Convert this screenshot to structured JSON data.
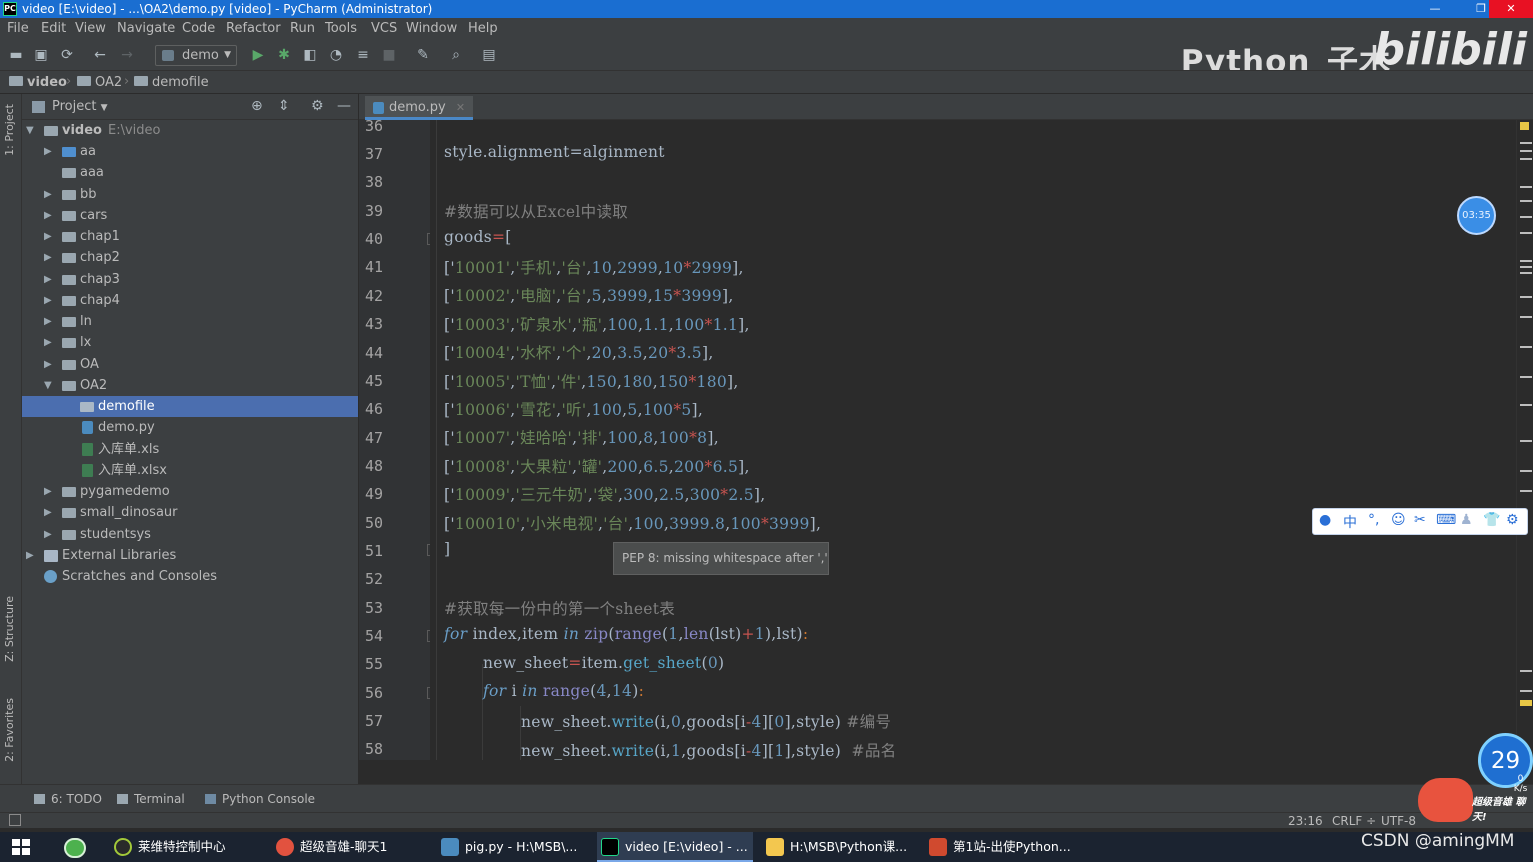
{
  "window": {
    "title": "video [E:\\video] - ...\\OA2\\demo.py [video] - PyCharm (Administrator)",
    "app_icon": "PC",
    "minimize": "—",
    "maximize": "❐",
    "close": "✕"
  },
  "menu": [
    "File",
    "Edit",
    "View",
    "Navigate",
    "Code",
    "Refactor",
    "Run",
    "Tools",
    "VCS",
    "Window",
    "Help"
  ],
  "toolbar": {
    "run_config": "demo"
  },
  "watermark": {
    "text": "Python_子木",
    "logo": "bilibili"
  },
  "breadcrumb": [
    "video",
    "OA2",
    "demofile"
  ],
  "left_strip": {
    "project_tab": "1: Project",
    "structure_tab": "Z: Structure",
    "favorites_tab": "2: Favorites"
  },
  "project": {
    "title": "Project",
    "root_label": "video",
    "root_path": "E:\\video",
    "items": [
      {
        "label": "aa"
      },
      {
        "label": "aaa"
      },
      {
        "label": "bb"
      },
      {
        "label": "cars"
      },
      {
        "label": "chap1"
      },
      {
        "label": "chap2"
      },
      {
        "label": "chap3"
      },
      {
        "label": "chap4"
      },
      {
        "label": "ln"
      },
      {
        "label": "lx"
      },
      {
        "label": "OA"
      },
      {
        "label": "OA2"
      },
      {
        "label": "demofile"
      },
      {
        "label": "demo.py"
      },
      {
        "label": "入库单.xls"
      },
      {
        "label": "入库单.xlsx"
      },
      {
        "label": "pygamedemo"
      },
      {
        "label": "small_dinosaur"
      },
      {
        "label": "studentsys"
      },
      {
        "label": "External Libraries"
      },
      {
        "label": "Scratches and Consoles"
      }
    ]
  },
  "editor": {
    "tab": "demo.py",
    "line_numbers": [
      "36",
      "37",
      "38",
      "39",
      "40",
      "41",
      "42",
      "43",
      "44",
      "45",
      "46",
      "47",
      "48",
      "49",
      "50",
      "51",
      "52",
      "53",
      "54",
      "55",
      "56",
      "57",
      "58"
    ],
    "lines": {
      "l37": "style.alignment=alginment",
      "l39": "#数据可以从Excel中读取",
      "l40_a": "goods",
      "l40_b": "=",
      "l40_c": "[",
      "l41": [
        "['",
        "10001'",
        ",",
        "'手机'",
        ",",
        "'台'",
        ",",
        "10",
        ",",
        "2999",
        ",",
        "10",
        "*",
        "2999",
        "],"
      ],
      "l42": [
        "['",
        "10002'",
        ",",
        "'电脑'",
        ",",
        "'台'",
        ",",
        "5",
        ",",
        "3999",
        ",",
        "15",
        "*",
        "3999",
        "],"
      ],
      "l43": [
        "['",
        "10003'",
        ",",
        "'矿泉水'",
        ",",
        "'瓶'",
        ",",
        "100",
        ",",
        "1.1",
        ",",
        "100",
        "*",
        "1.1",
        "],"
      ],
      "l44": [
        "['",
        "10004'",
        ",",
        "'水杯'",
        ",",
        "'个'",
        ",",
        "20",
        ",",
        "3.5",
        ",",
        "20",
        "*",
        "3.5",
        "],"
      ],
      "l45": [
        "['",
        "10005'",
        ",",
        "'T恤'",
        ",",
        "'件'",
        ",",
        "150",
        ",",
        "180",
        ",",
        "150",
        "*",
        "180",
        "],"
      ],
      "l46": [
        "['",
        "10006'",
        ",",
        "'雪花'",
        ",",
        "'听'",
        ",",
        "100",
        ",",
        "5",
        ",",
        "100",
        "*",
        "5",
        "],"
      ],
      "l47": [
        "['",
        "10007'",
        ",",
        "'娃哈哈'",
        ",",
        "'排'",
        ",",
        "100",
        ",",
        "8",
        ",",
        "100",
        "*",
        "8",
        "],"
      ],
      "l48": [
        "['",
        "10008'",
        ",",
        "'大果粒'",
        ",",
        "'罐'",
        ",",
        "200",
        ",",
        "6.5",
        ",",
        "200",
        "*",
        "6.5",
        "],"
      ],
      "l49": [
        "['",
        "10009'",
        ",",
        "'三元牛奶'",
        ",",
        "'袋'",
        ",",
        "300",
        ",",
        "2.5",
        ",",
        "300",
        "*",
        "2.5",
        "],"
      ],
      "l50": [
        "['",
        "100010'",
        ",",
        "'小米电视'",
        ",",
        "'台'",
        ",",
        "100",
        ",",
        "3999.8",
        ",",
        "100",
        "*",
        "3999",
        "],"
      ],
      "l51": "]",
      "l53": "#获取每一份中的第一个sheet表",
      "l54": {
        "for": "for",
        "a": " index,item ",
        "in": "in",
        "sp": " ",
        "zip": "zip",
        "p1": "(",
        "range": "range",
        "p2": "(",
        "one": "1",
        "c": ",",
        "len": "len",
        "rest": "(lst)",
        "plus": "+",
        "one2": "1",
        "end": "),lst)",
        "colon": ":"
      },
      "l55": {
        "a": "new_sheet",
        "eq": "=",
        "b": "item.",
        "fn": "get_sheet",
        "c": "(",
        "n": "0",
        "d": ")"
      },
      "l56": {
        "for": "for",
        "a": " i ",
        "in": "in",
        "sp": " ",
        "range": "range",
        "b": "(",
        "n1": "4",
        "c": ",",
        "n2": "14",
        "d": ")",
        "colon": ":"
      },
      "l57": {
        "a": "new_sheet.",
        "fn": "write",
        "b": "(i,",
        "n": "0",
        "c": ",goods[i",
        "op": "-",
        "n2": "4",
        "d": "][",
        "n3": "0",
        "e": "],style)",
        "cm": "#编号"
      },
      "l58": {
        "a": "new_sheet.",
        "fn": "write",
        "b": "(i,",
        "n": "1",
        "c": ",goods[i",
        "op": "-",
        "n2": "4",
        "d": "][",
        "n3": "1",
        "e": "],style)",
        "cm": "#品名"
      }
    },
    "tooltip": "PEP 8: missing whitespace after ','",
    "timer": "03:35"
  },
  "ime_bar": [
    "●",
    "中",
    "°,",
    "☺",
    "✂",
    "⌨",
    "♟",
    "👕",
    "⚙"
  ],
  "bottom_tools": {
    "todo": "6: TODO",
    "terminal": "Terminal",
    "console": "Python Console"
  },
  "status": {
    "position": "23:16",
    "line_sep": "CRLF ÷",
    "encoding": "UTF-8"
  },
  "net_widget": {
    "value": "29",
    "speed": "0 K/s"
  },
  "mascot_label": "超级音雄 聊天!",
  "taskbar": {
    "items": [
      {
        "label": "莱维特控制中心",
        "color": "#2a2a2a"
      },
      {
        "label": "超级音雄-聊天1",
        "color": "#e2523f"
      },
      {
        "label": "pig.py - H:\\MSB\\...",
        "color": "#4b8bbe"
      },
      {
        "label": "video [E:\\video] - ...",
        "color": "#21d789"
      },
      {
        "label": "H:\\MSB\\Python课...",
        "color": "#f3c74f"
      },
      {
        "label": "第1站-出使Python...",
        "color": "#d04a2f"
      }
    ],
    "csdn": "CSDN @amingMM"
  }
}
